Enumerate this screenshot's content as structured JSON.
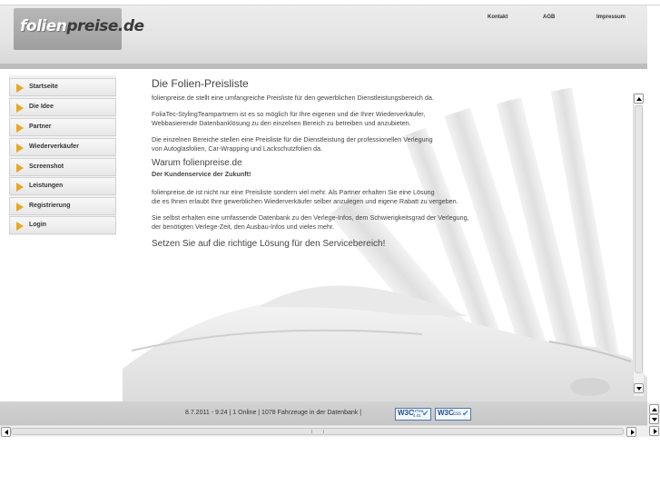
{
  "header": {
    "logo": {
      "part1": "folien",
      "part2": "preise.de"
    },
    "links": [
      {
        "label": "Kontakt"
      },
      {
        "label": "AGB"
      },
      {
        "label": "Impressum"
      }
    ]
  },
  "sidebar": {
    "items": [
      {
        "label": "Startseite"
      },
      {
        "label": "Die Idee"
      },
      {
        "label": "Partner"
      },
      {
        "label": "Wiederverkäufer"
      },
      {
        "label": "Screenshot"
      },
      {
        "label": "Leistungen"
      },
      {
        "label": "Registrierung"
      },
      {
        "label": "Login"
      }
    ]
  },
  "main": {
    "title": "Die Folien-Preisliste",
    "intro": "folienpreise.de stellt eine umfangreiche Preisliste für den gewerblichen Dienstleistungsbereich da.",
    "para2_line1": "FoliaTec-StylingTeampartnern ist es so möglich für Ihre eigenen und die Ihrer Wiederverkäufer,",
    "para2_line2": "Webbasierende Datenbanklösung zu den einzelnen Bereich zu betreiben und anzubieten.",
    "para3_line1": "Die einzelnen Bereiche stellen eine Preisliste für die Dienstleistung der professionellen Verlegung",
    "para3_line2": "von Autoglasfolien, Car-Wrapping und Lackschutzfolien da.",
    "subtitle": "Warum folienpreise.de",
    "bold_line": "Der Kundenservice der Zukunft!",
    "para4_line1": "folienpreise.de ist nicht nur eine Preisliste sondern viel mehr. Als Partner erhalten Sie eine Lösung",
    "para4_line2": "die es Ihnen erlaubt Ihre gewerblichen Wiederverkäufer selber anzulegen und eigene Rabatt zu vergeben.",
    "para5_line1": "Sie selbst erhalten eine umfassende Datenbank zu den Verlege-Infos, dem Schwierigkeitsgrad der Verlegung,",
    "para5_line2": "der benötigten Verlege-Zeit, den Ausbau-Infos und vieles mehr.",
    "cta": "Setzen Sie auf die richtige Lösung für den Servicebereich!"
  },
  "footer": {
    "status": "8.7.2011 - 9:24 | 1 Online | 1078 Fahrzeuge in der Datenbank |",
    "badge_html": {
      "w3c": "W3C",
      "label_top": "HTML",
      "label_bottom": "4.01"
    },
    "badge_css": {
      "w3c": "W3C",
      "label": "css"
    }
  },
  "colors": {
    "accent_arrow": "#e8a824",
    "header_bg": "#e4e4e4",
    "footer_bg": "#c9c9c9",
    "text": "#444444"
  },
  "icons": {
    "nav_bullet": "arrow-right-icon",
    "scroll_up": "chevron-up-icon",
    "scroll_down": "chevron-down-icon",
    "validator": "checkmark-icon"
  }
}
